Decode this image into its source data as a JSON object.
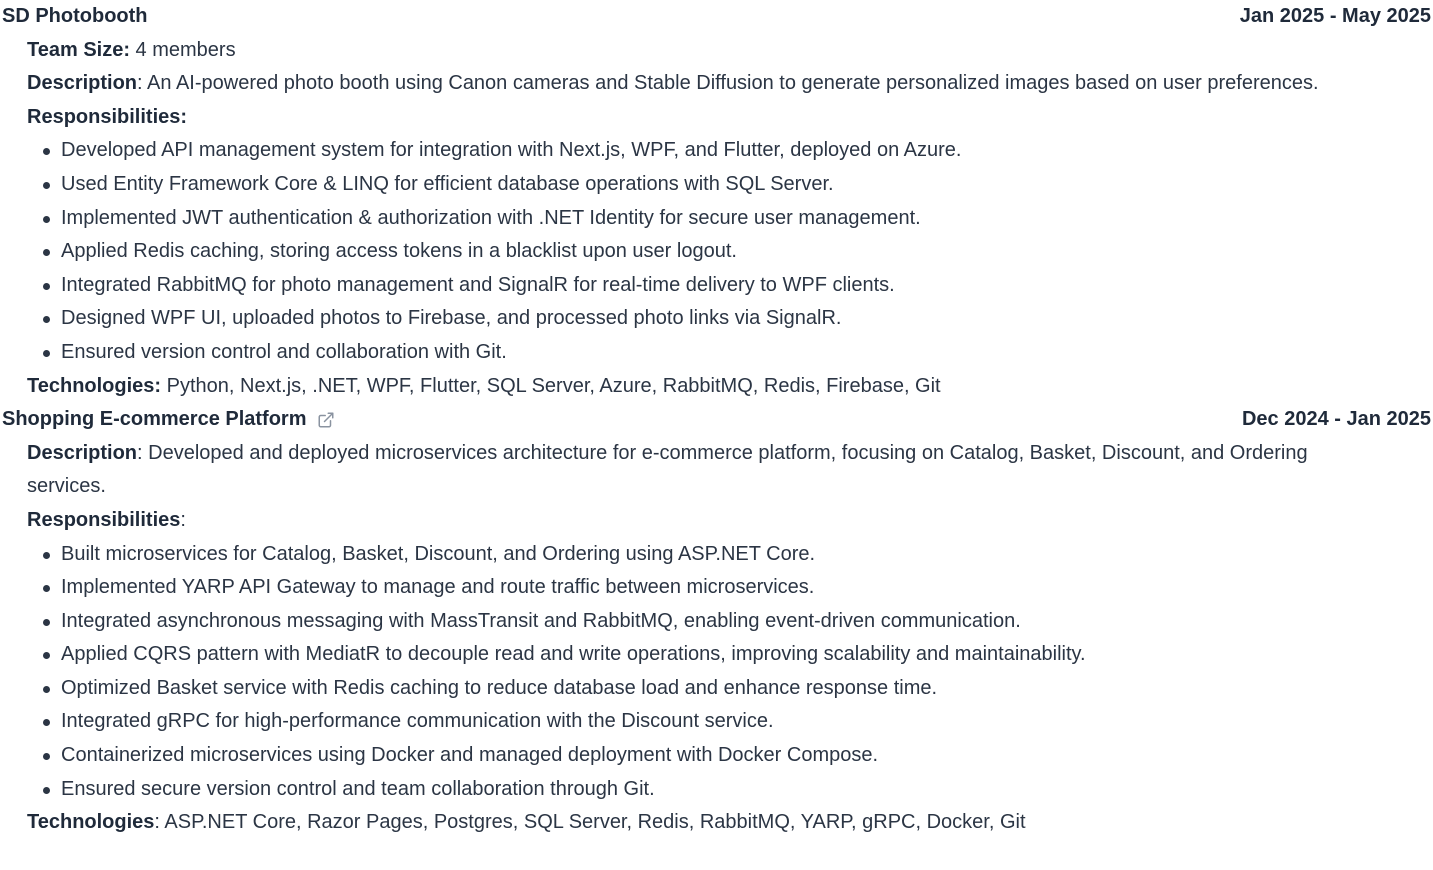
{
  "projects": [
    {
      "title": "SD Photobooth",
      "date": "Jan 2025 - May 2025",
      "team_label": "Team Size:",
      "team_value": " 4 members",
      "desc_label": "Description",
      "desc_text": ": An AI-powered photo booth using Canon cameras and Stable Diffusion to generate personalized images based on user preferences.",
      "resp_label": "Responsibilities:",
      "resp_suffix": "",
      "items": [
        "Developed API management system for integration with Next.js, WPF, and Flutter, deployed on Azure.",
        "Used Entity Framework Core & LINQ for efficient database operations with SQL Server.",
        "Implemented JWT authentication & authorization with .NET Identity for secure user management.",
        "Applied Redis caching, storing access tokens in a blacklist upon user logout.",
        "Integrated RabbitMQ for photo management and SignalR for real-time delivery to WPF clients.",
        "Designed WPF UI, uploaded photos to Firebase, and processed photo links via SignalR.",
        "Ensured version control and collaboration with Git."
      ],
      "tech_label": "Technologies:",
      "tech_text": " Python, Next.js, .NET, WPF, Flutter, SQL Server, Azure, RabbitMQ, Redis, Firebase, Git"
    },
    {
      "title": "Shopping E-commerce Platform",
      "link_icon": "external-link-icon",
      "date": "Dec 2024 - Jan 2025",
      "desc_label": "Description",
      "desc_text": ": Developed and deployed microservices architecture for e-commerce platform, focusing on Catalog, Basket, Discount, and Ordering services.",
      "resp_label": "Responsibilities",
      "resp_suffix": ":",
      "items": [
        "Built microservices for Catalog, Basket, Discount, and Ordering using ASP.NET Core.",
        "Implemented YARP API Gateway to manage and route traffic between microservices.",
        "Integrated asynchronous messaging with MassTransit and RabbitMQ, enabling event-driven communication.",
        "Applied CQRS pattern with MediatR to decouple read and write operations, improving scalability and maintainability.",
        "Optimized Basket service with Redis caching to reduce database load and enhance response time.",
        "Integrated gRPC for high-performance communication with the Discount service.",
        "Containerized microservices using Docker and managed deployment with Docker Compose.",
        "Ensured secure version control and team collaboration through Git."
      ],
      "tech_label": "Technologies",
      "tech_text": ": ASP.NET Core, Razor Pages, Postgres, SQL Server, Redis, RabbitMQ, YARP, gRPC, Docker, Git"
    }
  ]
}
